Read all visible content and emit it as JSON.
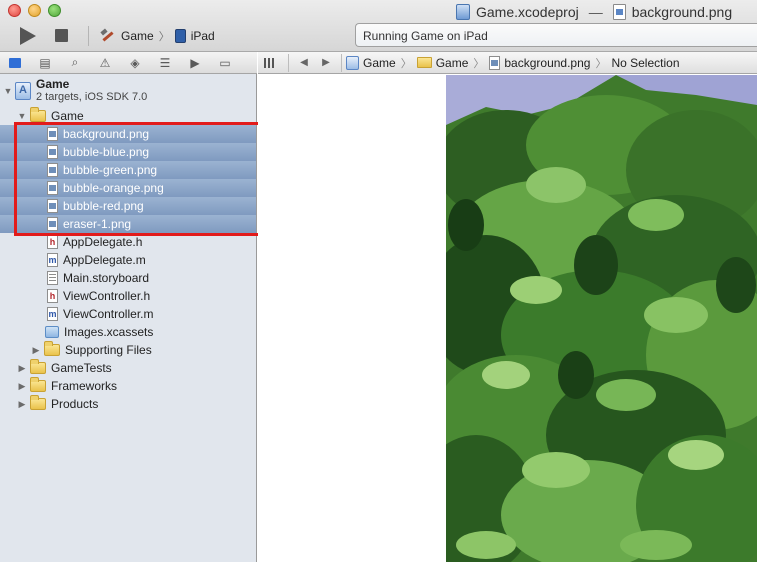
{
  "window": {
    "project_name": "Game.xcodeproj",
    "title_separator": "—",
    "file_name": "background.png"
  },
  "toolbar": {
    "scheme": "Game",
    "device": "iPad",
    "activity": "Running Game on iPad"
  },
  "navigator": {
    "project": {
      "name": "Game",
      "subtitle": "2 targets, iOS SDK 7.0"
    },
    "group": "Game",
    "selected_files": [
      {
        "label": "background.png",
        "type": "png"
      },
      {
        "label": "bubble-blue.png",
        "type": "png"
      },
      {
        "label": "bubble-green.png",
        "type": "png"
      },
      {
        "label": "bubble-orange.png",
        "type": "png"
      },
      {
        "label": "bubble-red.png",
        "type": "png"
      },
      {
        "label": "eraser-1.png",
        "type": "png"
      }
    ],
    "files": [
      {
        "label": "AppDelegate.h",
        "type": "h"
      },
      {
        "label": "AppDelegate.m",
        "type": "m"
      },
      {
        "label": "Main.storyboard",
        "type": "storyboard"
      },
      {
        "label": "ViewController.h",
        "type": "h"
      },
      {
        "label": "ViewController.m",
        "type": "m"
      },
      {
        "label": "Images.xcassets",
        "type": "xcassets"
      }
    ],
    "subgroup": "Supporting Files",
    "top_groups": [
      "GameTests",
      "Frameworks",
      "Products"
    ],
    "annotation_color": "#e21b1b"
  },
  "jumpbar": {
    "crumbs": [
      "Game",
      "Game",
      "background.png",
      "No Selection"
    ]
  },
  "editor": {
    "preview_description": "jungle foliage image preview"
  }
}
